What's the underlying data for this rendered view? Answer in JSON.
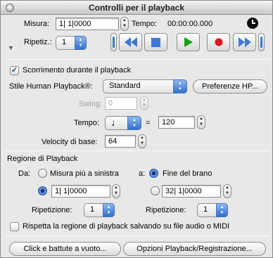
{
  "window": {
    "title": "Controlli per il playback"
  },
  "position": {
    "label": "Misura:",
    "value": "1| 1|0000"
  },
  "time": {
    "label": "Tempo:",
    "value": "00:00:00.000"
  },
  "repeat": {
    "label": "Ripetiz.:",
    "value": "1"
  },
  "transport": {
    "buttons": [
      "go-start",
      "rewind",
      "stop",
      "play",
      "record",
      "fast-forward",
      "go-end"
    ],
    "colors": {
      "accent": "#3d79d6",
      "play": "#16a216",
      "record": "#d41a1a"
    }
  },
  "scroll": {
    "label": "Scorrimento durante il playback",
    "checked": true
  },
  "human_playback": {
    "label": "Stile Human Playback®:",
    "value": "Standard",
    "prefs_button": "Preferenze HP..."
  },
  "swing": {
    "label": "Swing:",
    "value": "0"
  },
  "tempo": {
    "label": "Tempo:",
    "equals": "=",
    "value": "120",
    "note_symbol": "♩"
  },
  "velocity": {
    "label": "Velocity di base:",
    "value": "64"
  },
  "region": {
    "heading": "Regione di Playback",
    "from_label": "Da:",
    "from_leftmost": "Misura più a sinistra",
    "from_value": "1| 1|0000",
    "to_label": "a:",
    "to_end": "Fine del brano",
    "to_value": "32| 1|0000",
    "from_repeat_label": "Ripetizione:",
    "from_repeat_value": "1",
    "to_repeat_label": "Ripetizione:",
    "to_repeat_value": "1",
    "respect_label": "Rispetta la regione di playback salvando su file audio o MIDI",
    "respect_checked": false
  },
  "footer": {
    "click_button": "Click e battute a vuoto...",
    "options_button": "Opzioni Playback/Registrazione..."
  }
}
